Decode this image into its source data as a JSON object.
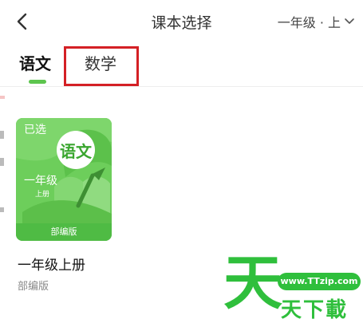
{
  "header": {
    "title": "课本选择",
    "grade_select": "一年级 · 上"
  },
  "tabs": [
    {
      "label": "语文",
      "active": true
    },
    {
      "label": "数学",
      "active": false
    }
  ],
  "book": {
    "badge": "已选",
    "subject": "语文",
    "grade": "一年级",
    "volume": "上册",
    "publisher_label": "部编版",
    "title": "一年级上册",
    "edition": "部编版"
  },
  "watermark": {
    "url": "www.TTzip.com",
    "brand": "天下載",
    "logo_char": "天"
  },
  "colors": {
    "accent": "#5dc54e",
    "highlight": "#d42025"
  }
}
